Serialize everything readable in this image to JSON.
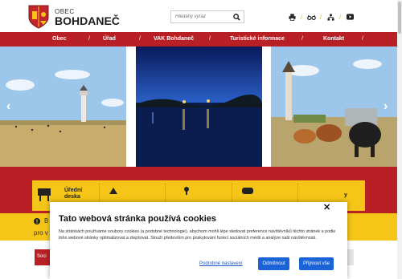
{
  "header": {
    "logo_small": "OBEC",
    "logo_big": "BOHDANEČ",
    "search_placeholder": "Hledaný výraz"
  },
  "icons": [
    "crest-logo",
    "search-icon",
    "print-icon",
    "glasses-icon",
    "sitemap-icon",
    "youtube-icon",
    "arrow-left-icon",
    "arrow-right-icon"
  ],
  "nav": {
    "items": [
      "Obec",
      "Úřad",
      "VAK Bohdaneč",
      "Turistické informace",
      "Kontakt"
    ],
    "separator": "/"
  },
  "quick_links": {
    "first": [
      "Úřední",
      "deska"
    ],
    "last": "y"
  },
  "notice": {
    "prefix": "B",
    "text": "pro v"
  },
  "social_tab": "Soci",
  "cookie": {
    "title": "Tato webová stránka používá cookies",
    "body": "Na stránkách používáme soubory cookies (a podobné technologie), abychom mohli lépe sledovat preference návštěvníků těchto stránek a podle toho webové stránky optimalizovat a zlepšovat. Slouží především pro poskytování funkcí sociálních médií a analýze naší návštěvnosti.",
    "settings_link": "Podrobné nastavení",
    "reject_label": "Odmítnout",
    "accept_label": "Přijmout vše",
    "close_label": "✕"
  },
  "colors": {
    "brand_red": "#b82025",
    "brand_yellow": "#f5c518",
    "button_blue": "#1a64d8"
  }
}
